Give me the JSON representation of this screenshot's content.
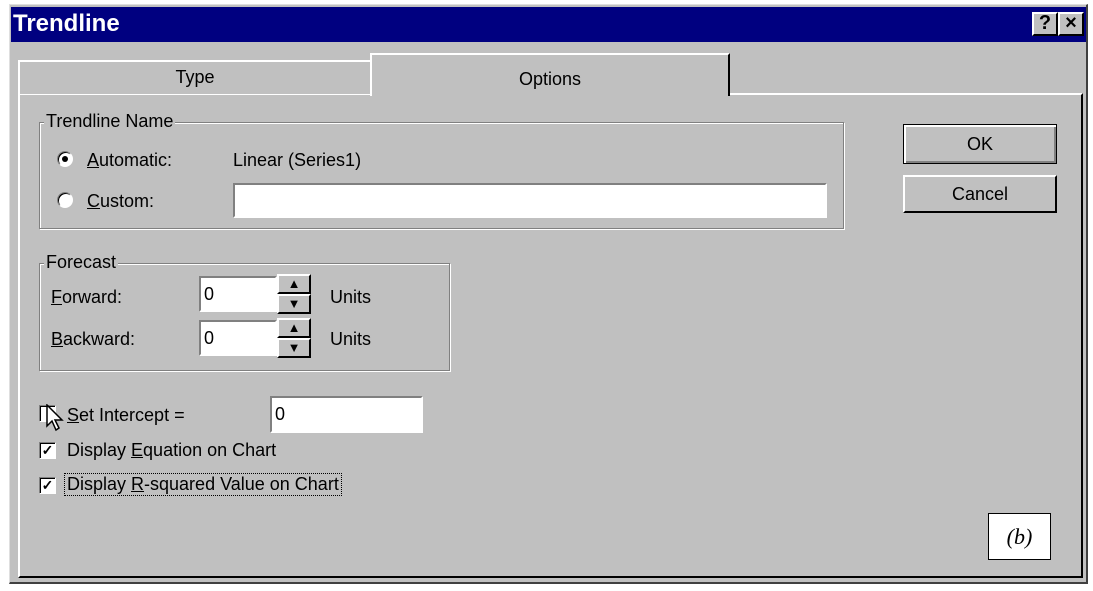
{
  "window": {
    "title": "Trendline",
    "help_label": "?",
    "close_label": "×"
  },
  "tabs": [
    {
      "label": "Type"
    },
    {
      "label": "Options",
      "active": true
    }
  ],
  "trendline_name": {
    "legend": "Trendline Name",
    "automatic": {
      "prefix": "",
      "mnemonic": "A",
      "rest": "utomatic:",
      "selected": true,
      "value": "Linear (Series1)"
    },
    "custom": {
      "prefix": "",
      "mnemonic": "C",
      "rest": "ustom:",
      "selected": false,
      "value": ""
    }
  },
  "forecast": {
    "legend": "Forecast",
    "forward": {
      "mnemonic": "F",
      "rest": "orward:",
      "value": "0",
      "units": "Units"
    },
    "backward": {
      "mnemonic": "B",
      "rest": "ackward:",
      "value": "0",
      "units": "Units"
    }
  },
  "options": {
    "set_intercept": {
      "mnemonic": "S",
      "rest": "et Intercept =",
      "checked": false,
      "value": "0"
    },
    "display_equation": {
      "pre": "Display ",
      "mnemonic": "E",
      "rest": "quation on Chart",
      "checked": true
    },
    "display_rsquared": {
      "pre": "Display ",
      "mnemonic": "R",
      "rest": "-squared Value on Chart",
      "checked": true
    }
  },
  "buttons": {
    "ok": "OK",
    "cancel": "Cancel"
  },
  "annotation": "(b)",
  "icons": {
    "check": "✓",
    "up": "▲",
    "down": "▼"
  },
  "colors": {
    "title_bar": "#000080",
    "face": "#c0c0c0"
  }
}
